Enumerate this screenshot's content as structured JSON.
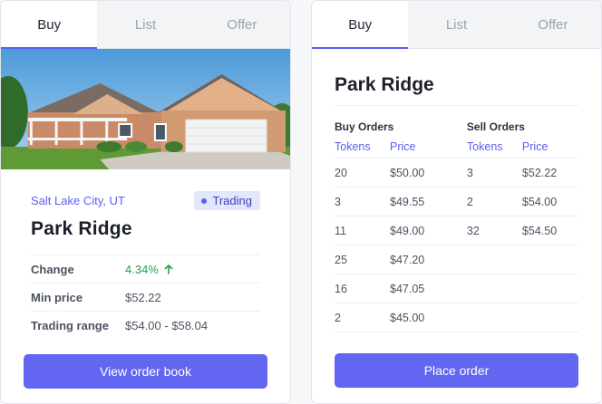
{
  "left_card": {
    "tabs": [
      {
        "label": "Buy",
        "active": true
      },
      {
        "label": "List",
        "active": false
      },
      {
        "label": "Offer",
        "active": false
      }
    ],
    "location": "Salt Lake City, UT",
    "status_badge": "Trading",
    "title": "Park Ridge",
    "details": [
      {
        "key": "Change",
        "value": "4.34%",
        "trend": "up"
      },
      {
        "key": "Min price",
        "value": "$52.22"
      },
      {
        "key": "Trading range",
        "value": "$54.00 - $58.04"
      }
    ],
    "button_label": "View order book"
  },
  "right_card": {
    "tabs": [
      {
        "label": "Buy",
        "active": true
      },
      {
        "label": "List",
        "active": false
      },
      {
        "label": "Offer",
        "active": false
      }
    ],
    "title": "Park Ridge",
    "buy_orders": {
      "heading": "Buy Orders",
      "columns": [
        "Tokens",
        "Price"
      ],
      "rows": [
        [
          "20",
          "$50.00"
        ],
        [
          "3",
          "$49.55"
        ],
        [
          "11",
          "$49.00"
        ],
        [
          "25",
          "$47.20"
        ],
        [
          "16",
          "$47.05"
        ],
        [
          "2",
          "$45.00"
        ]
      ]
    },
    "sell_orders": {
      "heading": "Sell Orders",
      "columns": [
        "Tokens",
        "Price"
      ],
      "rows": [
        [
          "3",
          "$52.22"
        ],
        [
          "2",
          "$54.00"
        ],
        [
          "32",
          "$54.50"
        ]
      ]
    },
    "button_label": "Place order"
  },
  "colors": {
    "accent": "#6366f1",
    "positive": "#1ea34f",
    "badge_bg": "#e4e6fb"
  }
}
